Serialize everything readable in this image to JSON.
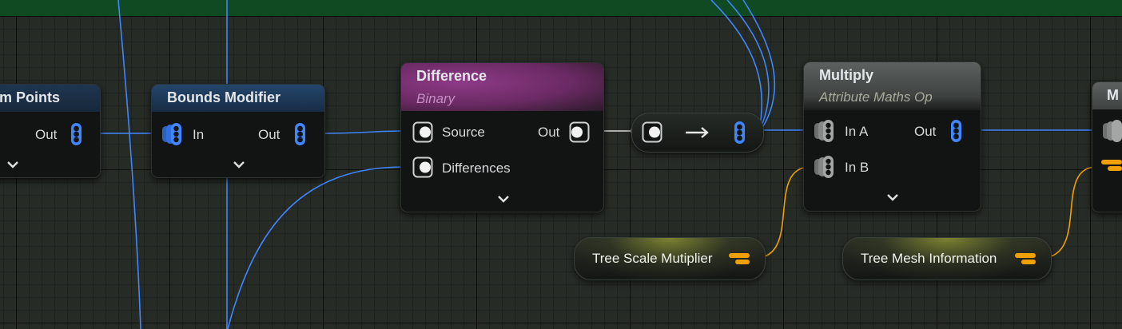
{
  "colors": {
    "graph_bg": "#262b26",
    "top_bar": "#0f4a23",
    "wire_spatial": "#3f86ff",
    "wire_param": "#f0a000",
    "difference_header": "#7a2f73",
    "multiply_header": "#545856",
    "bounds_header": "#1d3a5b"
  },
  "nodes": {
    "points": {
      "title": "m Points",
      "out_label": "Out"
    },
    "bounds_modifier": {
      "title": "Bounds Modifier",
      "in_label": "In",
      "out_label": "Out"
    },
    "difference": {
      "title": "Difference",
      "subtitle": "Binary",
      "source_label": "Source",
      "differences_label": "Differences",
      "out_label": "Out"
    },
    "multiply": {
      "title": "Multiply",
      "subtitle": "Attribute Maths Op",
      "in_a_label": "In A",
      "in_b_label": "In B",
      "out_label": "Out"
    },
    "next": {
      "title": "M"
    }
  },
  "params": {
    "tree_scale": {
      "label": "Tree Scale Mutiplier",
      "icon": "attribute-icon"
    },
    "tree_mesh": {
      "label": "Tree Mesh Information",
      "icon": "attribute-icon"
    }
  },
  "reroute": {
    "icon": "arrow-right-icon"
  }
}
